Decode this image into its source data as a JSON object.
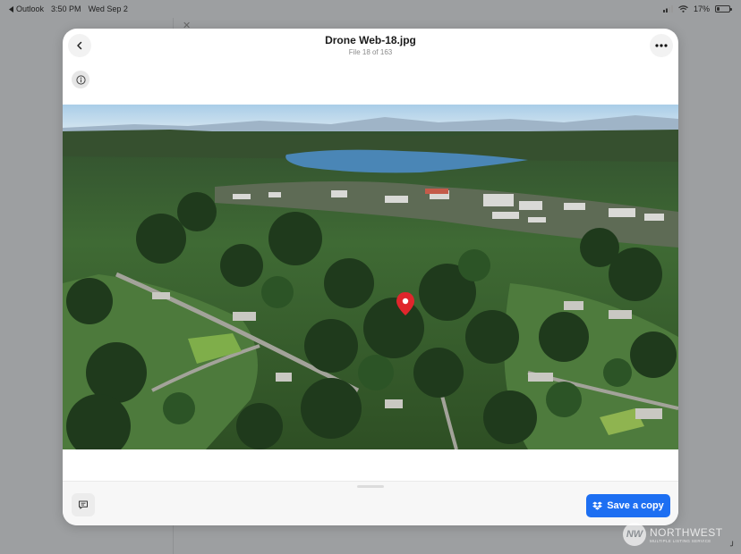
{
  "status_bar": {
    "back_app": "Outlook",
    "time": "3:50 PM",
    "date": "Wed Sep 2",
    "battery": "17%",
    "battery_level": 0.17
  },
  "viewer": {
    "title": "Drone Web-18.jpg",
    "counter": "File 18 of 163",
    "back_icon": "chevron-left-icon",
    "more_icon": "more-horizontal-icon",
    "info_icon": "info-icon"
  },
  "photo": {
    "subject": "aerial-drone-photo",
    "pin_color": "#e0262c"
  },
  "bottom_bar": {
    "comment_icon": "comment-icon",
    "save_label": "Save a copy",
    "save_icon": "dropbox-icon",
    "accent": "#1d6ff2"
  },
  "watermark": {
    "logo_text": "NW",
    "name": "NORTHWEST",
    "subtitle": "MULTIPLE LISTING SERVICE"
  }
}
